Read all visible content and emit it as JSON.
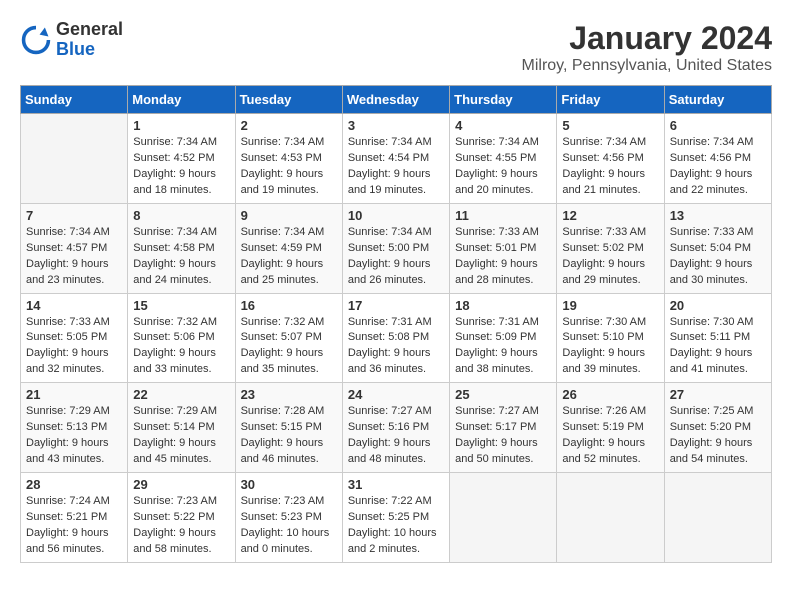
{
  "header": {
    "logo_line1": "General",
    "logo_line2": "Blue",
    "month_title": "January 2024",
    "location": "Milroy, Pennsylvania, United States"
  },
  "weekdays": [
    "Sunday",
    "Monday",
    "Tuesday",
    "Wednesday",
    "Thursday",
    "Friday",
    "Saturday"
  ],
  "weeks": [
    [
      {
        "day": "",
        "sunrise": "",
        "sunset": "",
        "daylight": ""
      },
      {
        "day": "1",
        "sunrise": "Sunrise: 7:34 AM",
        "sunset": "Sunset: 4:52 PM",
        "daylight": "Daylight: 9 hours and 18 minutes."
      },
      {
        "day": "2",
        "sunrise": "Sunrise: 7:34 AM",
        "sunset": "Sunset: 4:53 PM",
        "daylight": "Daylight: 9 hours and 19 minutes."
      },
      {
        "day": "3",
        "sunrise": "Sunrise: 7:34 AM",
        "sunset": "Sunset: 4:54 PM",
        "daylight": "Daylight: 9 hours and 19 minutes."
      },
      {
        "day": "4",
        "sunrise": "Sunrise: 7:34 AM",
        "sunset": "Sunset: 4:55 PM",
        "daylight": "Daylight: 9 hours and 20 minutes."
      },
      {
        "day": "5",
        "sunrise": "Sunrise: 7:34 AM",
        "sunset": "Sunset: 4:56 PM",
        "daylight": "Daylight: 9 hours and 21 minutes."
      },
      {
        "day": "6",
        "sunrise": "Sunrise: 7:34 AM",
        "sunset": "Sunset: 4:56 PM",
        "daylight": "Daylight: 9 hours and 22 minutes."
      }
    ],
    [
      {
        "day": "7",
        "sunrise": "Sunrise: 7:34 AM",
        "sunset": "Sunset: 4:57 PM",
        "daylight": "Daylight: 9 hours and 23 minutes."
      },
      {
        "day": "8",
        "sunrise": "Sunrise: 7:34 AM",
        "sunset": "Sunset: 4:58 PM",
        "daylight": "Daylight: 9 hours and 24 minutes."
      },
      {
        "day": "9",
        "sunrise": "Sunrise: 7:34 AM",
        "sunset": "Sunset: 4:59 PM",
        "daylight": "Daylight: 9 hours and 25 minutes."
      },
      {
        "day": "10",
        "sunrise": "Sunrise: 7:34 AM",
        "sunset": "Sunset: 5:00 PM",
        "daylight": "Daylight: 9 hours and 26 minutes."
      },
      {
        "day": "11",
        "sunrise": "Sunrise: 7:33 AM",
        "sunset": "Sunset: 5:01 PM",
        "daylight": "Daylight: 9 hours and 28 minutes."
      },
      {
        "day": "12",
        "sunrise": "Sunrise: 7:33 AM",
        "sunset": "Sunset: 5:02 PM",
        "daylight": "Daylight: 9 hours and 29 minutes."
      },
      {
        "day": "13",
        "sunrise": "Sunrise: 7:33 AM",
        "sunset": "Sunset: 5:04 PM",
        "daylight": "Daylight: 9 hours and 30 minutes."
      }
    ],
    [
      {
        "day": "14",
        "sunrise": "Sunrise: 7:33 AM",
        "sunset": "Sunset: 5:05 PM",
        "daylight": "Daylight: 9 hours and 32 minutes."
      },
      {
        "day": "15",
        "sunrise": "Sunrise: 7:32 AM",
        "sunset": "Sunset: 5:06 PM",
        "daylight": "Daylight: 9 hours and 33 minutes."
      },
      {
        "day": "16",
        "sunrise": "Sunrise: 7:32 AM",
        "sunset": "Sunset: 5:07 PM",
        "daylight": "Daylight: 9 hours and 35 minutes."
      },
      {
        "day": "17",
        "sunrise": "Sunrise: 7:31 AM",
        "sunset": "Sunset: 5:08 PM",
        "daylight": "Daylight: 9 hours and 36 minutes."
      },
      {
        "day": "18",
        "sunrise": "Sunrise: 7:31 AM",
        "sunset": "Sunset: 5:09 PM",
        "daylight": "Daylight: 9 hours and 38 minutes."
      },
      {
        "day": "19",
        "sunrise": "Sunrise: 7:30 AM",
        "sunset": "Sunset: 5:10 PM",
        "daylight": "Daylight: 9 hours and 39 minutes."
      },
      {
        "day": "20",
        "sunrise": "Sunrise: 7:30 AM",
        "sunset": "Sunset: 5:11 PM",
        "daylight": "Daylight: 9 hours and 41 minutes."
      }
    ],
    [
      {
        "day": "21",
        "sunrise": "Sunrise: 7:29 AM",
        "sunset": "Sunset: 5:13 PM",
        "daylight": "Daylight: 9 hours and 43 minutes."
      },
      {
        "day": "22",
        "sunrise": "Sunrise: 7:29 AM",
        "sunset": "Sunset: 5:14 PM",
        "daylight": "Daylight: 9 hours and 45 minutes."
      },
      {
        "day": "23",
        "sunrise": "Sunrise: 7:28 AM",
        "sunset": "Sunset: 5:15 PM",
        "daylight": "Daylight: 9 hours and 46 minutes."
      },
      {
        "day": "24",
        "sunrise": "Sunrise: 7:27 AM",
        "sunset": "Sunset: 5:16 PM",
        "daylight": "Daylight: 9 hours and 48 minutes."
      },
      {
        "day": "25",
        "sunrise": "Sunrise: 7:27 AM",
        "sunset": "Sunset: 5:17 PM",
        "daylight": "Daylight: 9 hours and 50 minutes."
      },
      {
        "day": "26",
        "sunrise": "Sunrise: 7:26 AM",
        "sunset": "Sunset: 5:19 PM",
        "daylight": "Daylight: 9 hours and 52 minutes."
      },
      {
        "day": "27",
        "sunrise": "Sunrise: 7:25 AM",
        "sunset": "Sunset: 5:20 PM",
        "daylight": "Daylight: 9 hours and 54 minutes."
      }
    ],
    [
      {
        "day": "28",
        "sunrise": "Sunrise: 7:24 AM",
        "sunset": "Sunset: 5:21 PM",
        "daylight": "Daylight: 9 hours and 56 minutes."
      },
      {
        "day": "29",
        "sunrise": "Sunrise: 7:23 AM",
        "sunset": "Sunset: 5:22 PM",
        "daylight": "Daylight: 9 hours and 58 minutes."
      },
      {
        "day": "30",
        "sunrise": "Sunrise: 7:23 AM",
        "sunset": "Sunset: 5:23 PM",
        "daylight": "Daylight: 10 hours and 0 minutes."
      },
      {
        "day": "31",
        "sunrise": "Sunrise: 7:22 AM",
        "sunset": "Sunset: 5:25 PM",
        "daylight": "Daylight: 10 hours and 2 minutes."
      },
      {
        "day": "",
        "sunrise": "",
        "sunset": "",
        "daylight": ""
      },
      {
        "day": "",
        "sunrise": "",
        "sunset": "",
        "daylight": ""
      },
      {
        "day": "",
        "sunrise": "",
        "sunset": "",
        "daylight": ""
      }
    ]
  ]
}
